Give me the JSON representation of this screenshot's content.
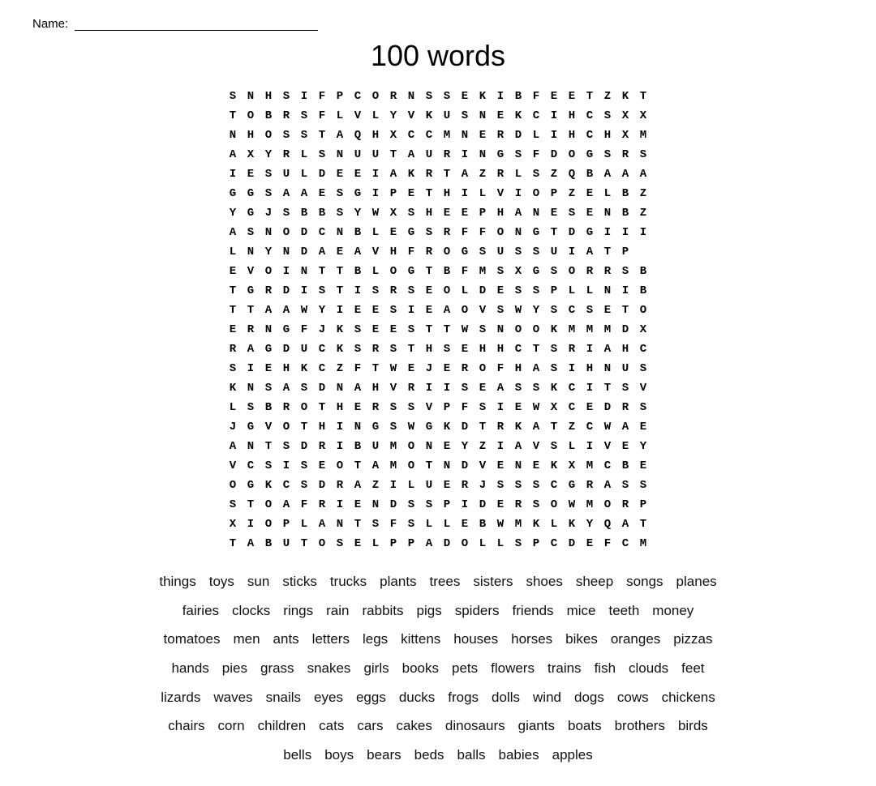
{
  "header": {
    "name_label": "Name:",
    "title": "100 words"
  },
  "grid": {
    "rows": [
      [
        "S",
        "N",
        "H",
        "S",
        "I",
        "F",
        "P",
        "C",
        "O",
        "R",
        "N",
        "S",
        "S",
        "E",
        "K",
        "I",
        "B",
        "F",
        "E",
        "E",
        "T",
        "Z",
        "K",
        "T"
      ],
      [
        "T",
        "O",
        "B",
        "R",
        "S",
        "F",
        "L",
        "V",
        "L",
        "Y",
        "V",
        "K",
        "U",
        "S",
        "N",
        "E",
        "K",
        "C",
        "I",
        "H",
        "C",
        "S",
        "X",
        "X"
      ],
      [
        "N",
        "H",
        "O",
        "S",
        "S",
        "T",
        "A",
        "Q",
        "H",
        "X",
        "C",
        "C",
        "M",
        "N",
        "E",
        "R",
        "D",
        "L",
        "I",
        "H",
        "C",
        "H",
        "X",
        "M"
      ],
      [
        "A",
        "X",
        "Y",
        "R",
        "L",
        "S",
        "N",
        "U",
        "U",
        "T",
        "A",
        "U",
        "R",
        "I",
        "N",
        "G",
        "S",
        "F",
        "D",
        "O",
        "G",
        "S",
        "R",
        "S"
      ],
      [
        "I",
        "E",
        "S",
        "U",
        "L",
        "D",
        "E",
        "E",
        "I",
        "A",
        "K",
        "R",
        "T",
        "A",
        "Z",
        "R",
        "L",
        "S",
        "Z",
        "Q",
        "B",
        "A",
        "A",
        "A"
      ],
      [
        "G",
        "G",
        "S",
        "A",
        "A",
        "E",
        "S",
        "G",
        "I",
        "P",
        "E",
        "T",
        "H",
        "I",
        "L",
        "V",
        "I",
        "O",
        "P",
        "Z",
        "E",
        "L",
        "B",
        "Z"
      ],
      [
        "Y",
        "G",
        "J",
        "S",
        "B",
        "B",
        "S",
        "Y",
        "W",
        "X",
        "S",
        "H",
        "E",
        "E",
        "P",
        "H",
        "A",
        "N",
        "E",
        "S",
        "E",
        "N",
        "B",
        "Z"
      ],
      [
        "A",
        "S",
        "N",
        "O",
        "D",
        "C",
        "N",
        "B",
        "L",
        "E",
        "G",
        "S",
        "R",
        "F",
        "F",
        "O",
        "N",
        "G",
        "T",
        "D",
        "G",
        "I",
        "I",
        "I"
      ],
      [
        "L",
        "N",
        "Y",
        "N",
        "D",
        "A",
        "E",
        "A",
        "V",
        "H",
        "F",
        "R",
        "O",
        "G",
        "S",
        "U",
        "S",
        "S",
        "U",
        "I",
        "A",
        "T",
        "P",
        ""
      ],
      [
        "E",
        "V",
        "O",
        "I",
        "N",
        "T",
        "T",
        "B",
        "L",
        "O",
        "G",
        "T",
        "B",
        "F",
        "M",
        "S",
        "X",
        "G",
        "S",
        "O",
        "R",
        "R",
        "S",
        "B"
      ],
      [
        "T",
        "G",
        "R",
        "D",
        "I",
        "S",
        "T",
        "I",
        "S",
        "R",
        "S",
        "E",
        "O",
        "L",
        "D",
        "E",
        "S",
        "S",
        "P",
        "L",
        "L",
        "N",
        "I",
        "B"
      ],
      [
        "T",
        "T",
        "A",
        "A",
        "W",
        "Y",
        "I",
        "E",
        "E",
        "S",
        "I",
        "E",
        "A",
        "O",
        "V",
        "S",
        "W",
        "Y",
        "S",
        "C",
        "S",
        "E",
        "T",
        "O"
      ],
      [
        "E",
        "R",
        "N",
        "G",
        "F",
        "J",
        "K",
        "S",
        "E",
        "E",
        "S",
        "T",
        "T",
        "W",
        "S",
        "N",
        "O",
        "O",
        "K",
        "M",
        "M",
        "M",
        "D",
        "X"
      ],
      [
        "R",
        "A",
        "G",
        "D",
        "U",
        "C",
        "K",
        "S",
        "R",
        "S",
        "T",
        "H",
        "S",
        "E",
        "H",
        "H",
        "C",
        "T",
        "S",
        "R",
        "I",
        "A",
        "H",
        "C"
      ],
      [
        "S",
        "I",
        "E",
        "H",
        "K",
        "C",
        "Z",
        "F",
        "T",
        "W",
        "E",
        "J",
        "E",
        "R",
        "O",
        "F",
        "H",
        "A",
        "S",
        "I",
        "H",
        "N",
        "U",
        "S"
      ],
      [
        "K",
        "N",
        "S",
        "A",
        "S",
        "D",
        "N",
        "A",
        "H",
        "V",
        "R",
        "I",
        "I",
        "S",
        "E",
        "A",
        "S",
        "S",
        "K",
        "C",
        "I",
        "T",
        "S",
        "V"
      ],
      [
        "L",
        "S",
        "B",
        "R",
        "O",
        "T",
        "H",
        "E",
        "R",
        "S",
        "S",
        "V",
        "P",
        "F",
        "S",
        "I",
        "E",
        "W",
        "X",
        "C",
        "E",
        "D",
        "R",
        "S"
      ],
      [
        "J",
        "G",
        "V",
        "O",
        "T",
        "H",
        "I",
        "N",
        "G",
        "S",
        "W",
        "G",
        "K",
        "D",
        "T",
        "R",
        "K",
        "A",
        "T",
        "Z",
        "C",
        "W",
        "A",
        "E"
      ],
      [
        "A",
        "N",
        "T",
        "S",
        "D",
        "R",
        "I",
        "B",
        "U",
        "M",
        "O",
        "N",
        "E",
        "Y",
        "Z",
        "I",
        "A",
        "V",
        "S",
        "L",
        "I",
        "V",
        "E",
        "Y"
      ],
      [
        "V",
        "C",
        "S",
        "I",
        "S",
        "E",
        "O",
        "T",
        "A",
        "M",
        "O",
        "T",
        "N",
        "D",
        "V",
        "E",
        "N",
        "E",
        "K",
        "X",
        "M",
        "C",
        "B",
        "E"
      ],
      [
        "O",
        "G",
        "K",
        "C",
        "S",
        "D",
        "R",
        "A",
        "Z",
        "I",
        "L",
        "U",
        "E",
        "R",
        "J",
        "S",
        "S",
        "S",
        "C",
        "G",
        "R",
        "A",
        "S",
        "S"
      ],
      [
        "S",
        "T",
        "O",
        "A",
        "F",
        "R",
        "I",
        "E",
        "N",
        "D",
        "S",
        "S",
        "P",
        "I",
        "D",
        "E",
        "R",
        "S",
        "O",
        "W",
        "M",
        "O",
        "R",
        "P"
      ],
      [
        "X",
        "I",
        "O",
        "P",
        "L",
        "A",
        "N",
        "T",
        "S",
        "F",
        "S",
        "L",
        "L",
        "E",
        "B",
        "W",
        "M",
        "K",
        "L",
        "K",
        "Y",
        "Q",
        "A",
        "T"
      ],
      [
        "T",
        "A",
        "B",
        "U",
        "T",
        "O",
        "S",
        "E",
        "L",
        "P",
        "P",
        "A",
        "D",
        "O",
        "L",
        "L",
        "S",
        "P",
        "C",
        "D",
        "E",
        "F",
        "C",
        "M"
      ]
    ]
  },
  "word_list": [
    [
      "things",
      "toys",
      "sun",
      "sticks",
      "trucks",
      "plants",
      "trees",
      "sisters",
      "shoes",
      "sheep",
      "songs",
      "planes"
    ],
    [
      "fairies",
      "clocks",
      "rings",
      "rain",
      "rabbits",
      "pigs",
      "spiders",
      "friends",
      "mice",
      "teeth",
      "money"
    ],
    [
      "tomatoes",
      "men",
      "ants",
      "letters",
      "legs",
      "kittens",
      "houses",
      "horses",
      "bikes",
      "oranges",
      "pizzas"
    ],
    [
      "hands",
      "pies",
      "grass",
      "snakes",
      "girls",
      "books",
      "pets",
      "flowers",
      "trains",
      "fish",
      "clouds",
      "feet"
    ],
    [
      "lizards",
      "waves",
      "snails",
      "eyes",
      "eggs",
      "ducks",
      "frogs",
      "dolls",
      "wind",
      "dogs",
      "cows",
      "chickens"
    ],
    [
      "chairs",
      "corn",
      "children",
      "cats",
      "cars",
      "cakes",
      "dinosaurs",
      "giants",
      "boats",
      "brothers",
      "birds"
    ],
    [
      "bells",
      "boys",
      "bears",
      "beds",
      "balls",
      "babies",
      "apples"
    ]
  ]
}
